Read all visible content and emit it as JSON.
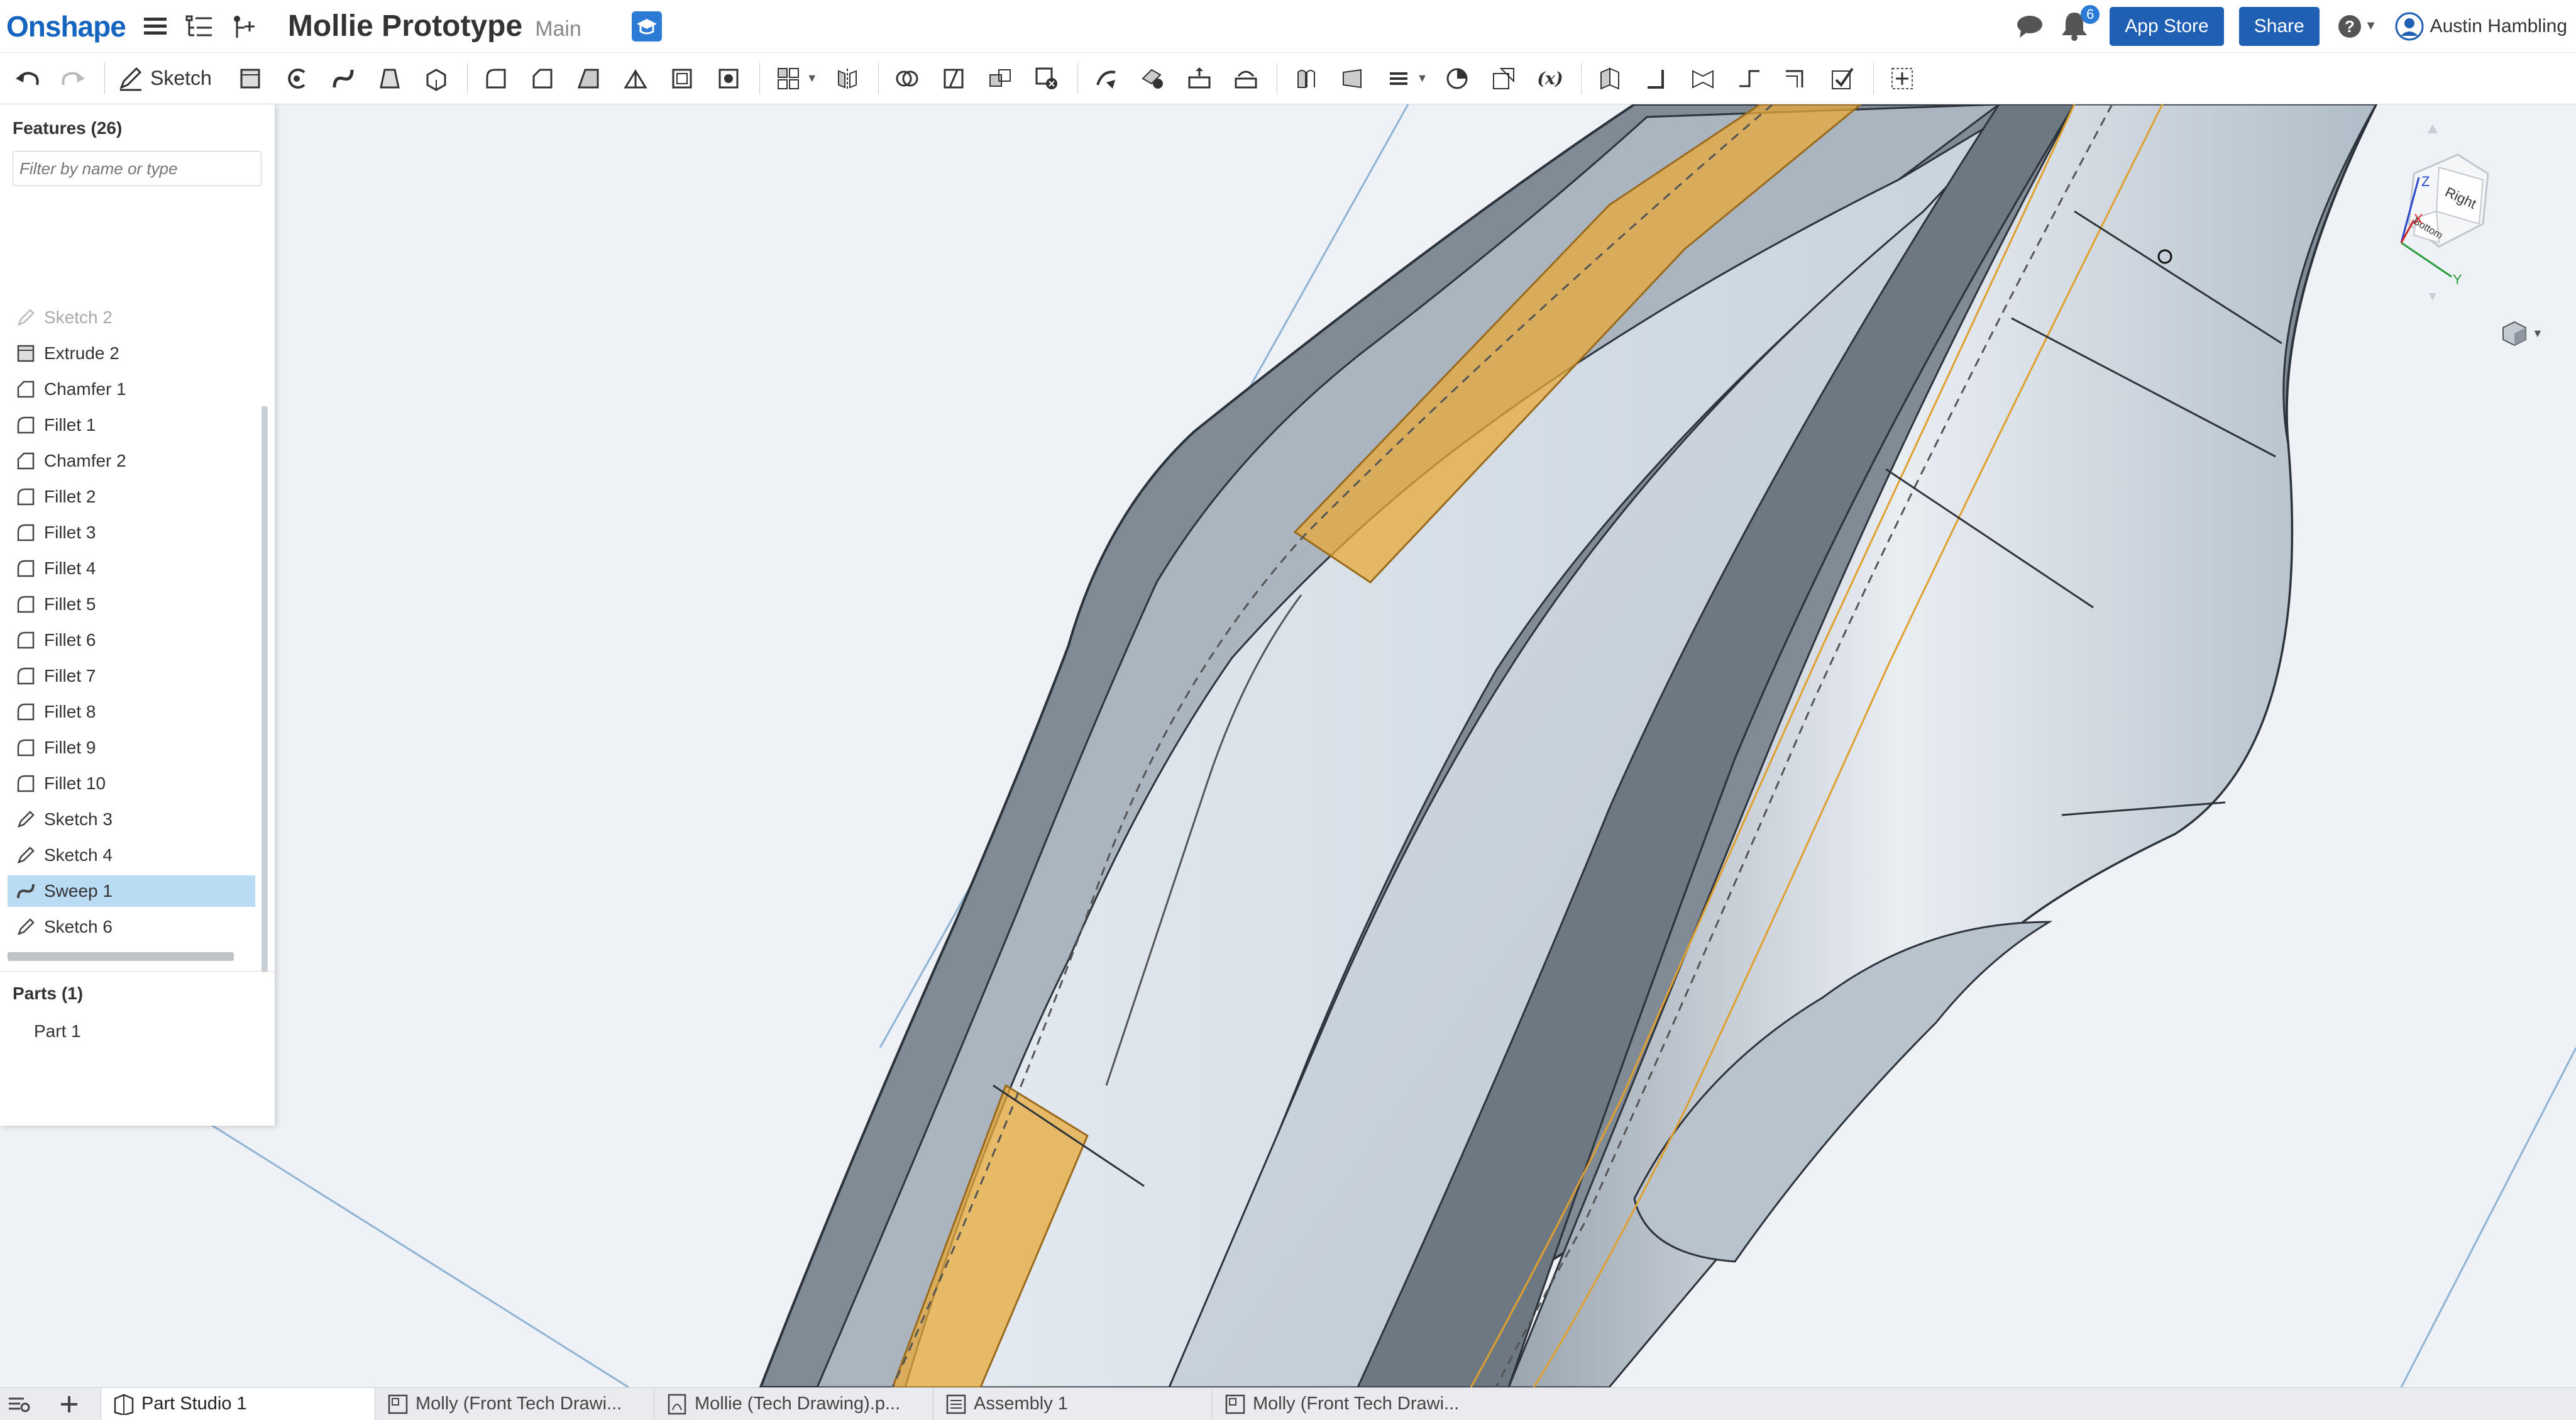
{
  "header": {
    "logo": "Onshape",
    "document_title": "Mollie Prototype",
    "branch": "Main",
    "notifications_count": "6",
    "app_store_label": "App Store",
    "share_label": "Share",
    "user_name": "Austin Hambling"
  },
  "toolbar": {
    "sketch_label": "Sketch"
  },
  "feature_panel": {
    "title": "Features (26)",
    "filter_placeholder": "Filter by name or type",
    "items": [
      {
        "label": "Sketch 2",
        "icon": "sketch-icon",
        "dim": true
      },
      {
        "label": "Extrude 2",
        "icon": "extrude-icon"
      },
      {
        "label": "Chamfer 1",
        "icon": "chamfer-icon"
      },
      {
        "label": "Fillet 1",
        "icon": "fillet-icon"
      },
      {
        "label": "Chamfer 2",
        "icon": "chamfer-icon"
      },
      {
        "label": "Fillet 2",
        "icon": "fillet-icon"
      },
      {
        "label": "Fillet 3",
        "icon": "fillet-icon"
      },
      {
        "label": "Fillet 4",
        "icon": "fillet-icon"
      },
      {
        "label": "Fillet 5",
        "icon": "fillet-icon"
      },
      {
        "label": "Fillet 6",
        "icon": "fillet-icon"
      },
      {
        "label": "Fillet 7",
        "icon": "fillet-icon"
      },
      {
        "label": "Fillet 8",
        "icon": "fillet-icon"
      },
      {
        "label": "Fillet 9",
        "icon": "fillet-icon"
      },
      {
        "label": "Fillet 10",
        "icon": "fillet-icon"
      },
      {
        "label": "Sketch 3",
        "icon": "sketch-icon"
      },
      {
        "label": "Sketch 4",
        "icon": "sketch-icon"
      },
      {
        "label": "Sweep 1",
        "icon": "sweep-icon",
        "selected": true
      },
      {
        "label": "Sketch 6",
        "icon": "sketch-icon"
      }
    ],
    "parts_title": "Parts (1)",
    "parts": [
      "Part 1"
    ]
  },
  "view_cube": {
    "front_face": "Right",
    "bottom_face": "Bottom",
    "axis_x": "X",
    "axis_y": "Y",
    "axis_z": "Z"
  },
  "tabs": [
    {
      "label": "Part Studio 1",
      "icon": "part-studio-icon",
      "active": true
    },
    {
      "label": "Molly (Front Tech Drawi...",
      "icon": "drawing-icon"
    },
    {
      "label": "Mollie (Tech Drawing).p...",
      "icon": "pdf-icon"
    },
    {
      "label": "Assembly 1",
      "icon": "assembly-icon"
    },
    {
      "label": "Molly (Front Tech Drawi...",
      "icon": "drawing-icon"
    }
  ],
  "colors": {
    "brand": "#1565c0",
    "accent_button": "#1f5fb4",
    "selection": "#b9dcf4",
    "highlight_face": "#e8a93a"
  }
}
